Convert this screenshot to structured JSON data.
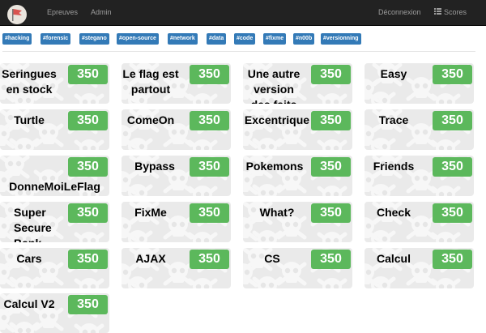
{
  "navbar": {
    "links": [
      "Epreuves",
      "Admin"
    ],
    "logout": "Déconnexion",
    "scores": "Scores",
    "colors": {
      "background": "#222222",
      "link": "#9d9d9d"
    }
  },
  "tags": [
    "#hacking",
    "#forensic",
    "#stegano",
    "#open-source",
    "#network",
    "#data",
    "#code",
    "#fixme",
    "#n00b",
    "#versionning"
  ],
  "tag_color": "#337ab7",
  "challenges": [
    {
      "title": "Seringues en stock",
      "points": "350"
    },
    {
      "title": "Le flag est partout",
      "points": "350"
    },
    {
      "title": "Une autre version des faits",
      "points": "350"
    },
    {
      "title": "Easy",
      "points": "350"
    },
    {
      "title": "Turtle",
      "points": "350"
    },
    {
      "title": "ComeOn",
      "points": "350"
    },
    {
      "title": "Excentrique",
      "points": "350"
    },
    {
      "title": "Trace",
      "points": "350"
    },
    {
      "title": "DonneMoiLeFlag",
      "points": "350"
    },
    {
      "title": "Bypass",
      "points": "350"
    },
    {
      "title": "Pokemons",
      "points": "350"
    },
    {
      "title": "Friends",
      "points": "350"
    },
    {
      "title": "Super Secure Bank",
      "points": "350"
    },
    {
      "title": "FixMe",
      "points": "350"
    },
    {
      "title": "What?",
      "points": "350"
    },
    {
      "title": "Check",
      "points": "350"
    },
    {
      "title": "Cars",
      "points": "350"
    },
    {
      "title": "AJAX",
      "points": "350"
    },
    {
      "title": "CS",
      "points": "350"
    },
    {
      "title": "Calcul",
      "points": "350"
    },
    {
      "title": "Calcul V2",
      "points": "350"
    }
  ],
  "points_color": "#5cb85c"
}
